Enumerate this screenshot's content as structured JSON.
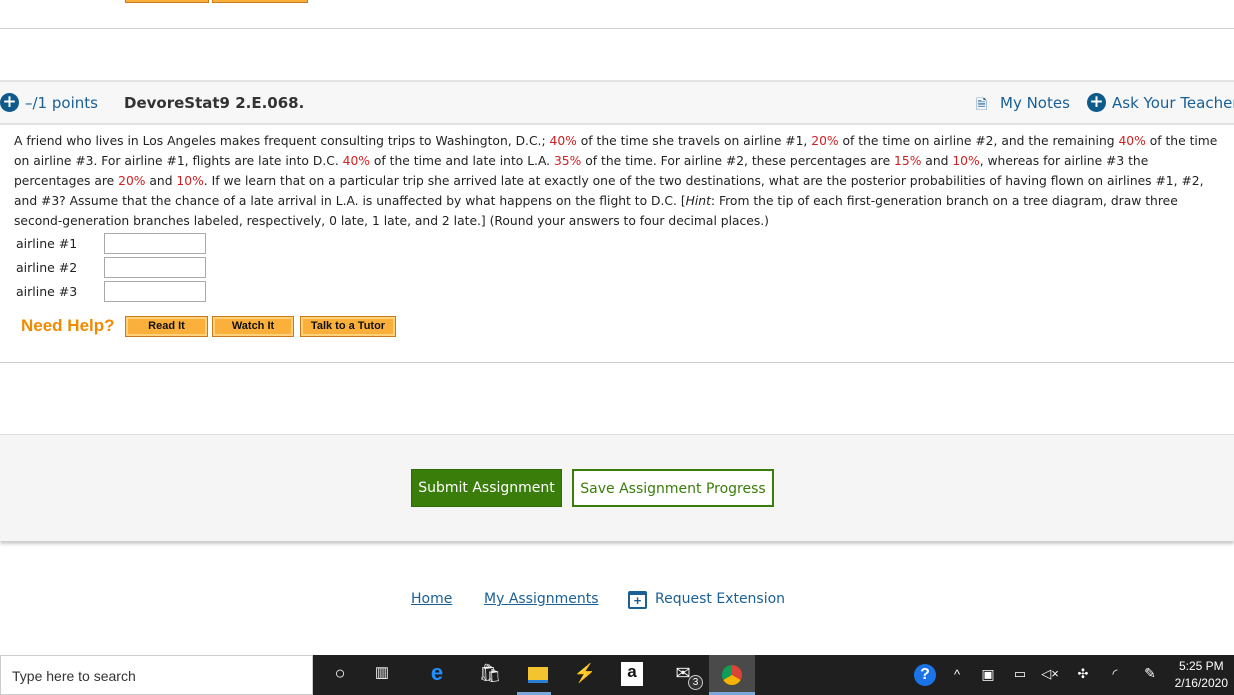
{
  "question": {
    "points": "–/1 points",
    "id": "DevoreStat9 2.E.068.",
    "my_notes": "My Notes",
    "ask_teacher": "Ask Your Teacher",
    "text_segments": [
      {
        "t": "A friend who lives in Los Angeles makes frequent consulting trips to Washington, D.C.; "
      },
      {
        "t": "40%",
        "red": true
      },
      {
        "t": " of the time she travels on airline #1, "
      },
      {
        "t": "20%",
        "red": true
      },
      {
        "t": " of the time on airline #2, and the remaining "
      },
      {
        "t": "40%",
        "red": true
      },
      {
        "t": " of the time on airline #3. For airline #1, flights are late into D.C. "
      },
      {
        "t": "40%",
        "red": true
      },
      {
        "t": " of the time and late into L.A. "
      },
      {
        "t": "35%",
        "red": true
      },
      {
        "t": " of the time. For airline #2, these percentages are "
      },
      {
        "t": "15%",
        "red": true
      },
      {
        "t": " and "
      },
      {
        "t": "10%",
        "red": true
      },
      {
        "t": ", whereas for airline #3 the percentages are "
      },
      {
        "t": "20%",
        "red": true
      },
      {
        "t": " and "
      },
      {
        "t": "10%",
        "red": true
      },
      {
        "t": ". If we learn that on a particular trip she arrived late at exactly one of the two destinations, what are the posterior probabilities of having flown on airlines #1, #2, and #3? Assume that the chance of a late arrival in L.A. is unaffected by what happens on the flight to D.C. ["
      },
      {
        "t": "Hint",
        "italic": true
      },
      {
        "t": ": From the tip of each first-generation branch on a tree diagram, draw three second-generation branches labeled, respectively, 0 late, 1 late, and 2 late.] (Round your answers to four decimal places.)"
      }
    ],
    "answers": [
      {
        "label": "airline #1",
        "value": ""
      },
      {
        "label": "airline #2",
        "value": ""
      },
      {
        "label": "airline #3",
        "value": ""
      }
    ],
    "need_help": "Need Help?",
    "help_buttons": [
      "Read It",
      "Watch It",
      "Talk to a Tutor"
    ]
  },
  "actions": {
    "submit": "Submit Assignment",
    "save": "Save Assignment Progress"
  },
  "footer": {
    "home": "Home",
    "my_assignments": "My Assignments",
    "request_extension": "Request Extension"
  },
  "taskbar": {
    "search_placeholder": "Type here to search",
    "time": "5:25 PM",
    "date": "2/16/2020",
    "mail_badge": "3",
    "icons": [
      "cortana-icon",
      "task-view-icon",
      "edge-icon",
      "store-icon",
      "file-explorer-icon",
      "app-icon",
      "amazon-icon",
      "mail-icon",
      "chrome-icon"
    ]
  },
  "colors": {
    "accent_blue": "#1a5f95",
    "submit_green": "#3a7d0a",
    "help_orange": "#f08a00",
    "red": "#d02020"
  }
}
